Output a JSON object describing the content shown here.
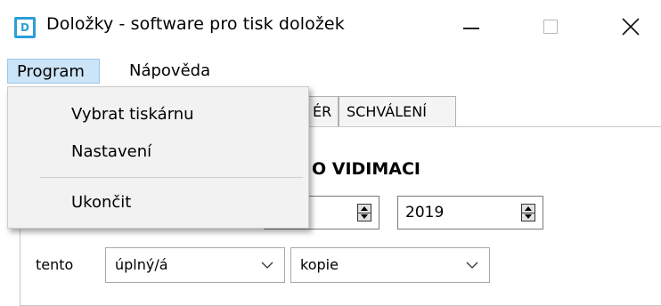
{
  "window": {
    "app_icon_letter": "D",
    "title": "Doložky - software pro tisk doložek",
    "controls": {
      "minimize": "minimize-icon",
      "maximize": "maximize-icon",
      "close": "close-icon"
    }
  },
  "menubar": {
    "program": "Program",
    "help": "Nápověda"
  },
  "program_menu": {
    "items": [
      "Vybrat tiskárnu",
      "Nastavení",
      "Ukončit"
    ]
  },
  "tabs": [
    "ÉR",
    "SCHVÁLENÍ"
  ],
  "form": {
    "heading": "O VIDIMACI",
    "spin1_value": "",
    "spin2_value": "2019",
    "tento_label": "tento",
    "combo1_value": "úplný/á",
    "combo2_value": "kopie"
  },
  "colors": {
    "menu_highlight": "#cce4f7",
    "menu_highlight_border": "#99c9ef",
    "dropdown_bg": "#f2f2f2",
    "icon_accent": "#2a9fd8"
  }
}
